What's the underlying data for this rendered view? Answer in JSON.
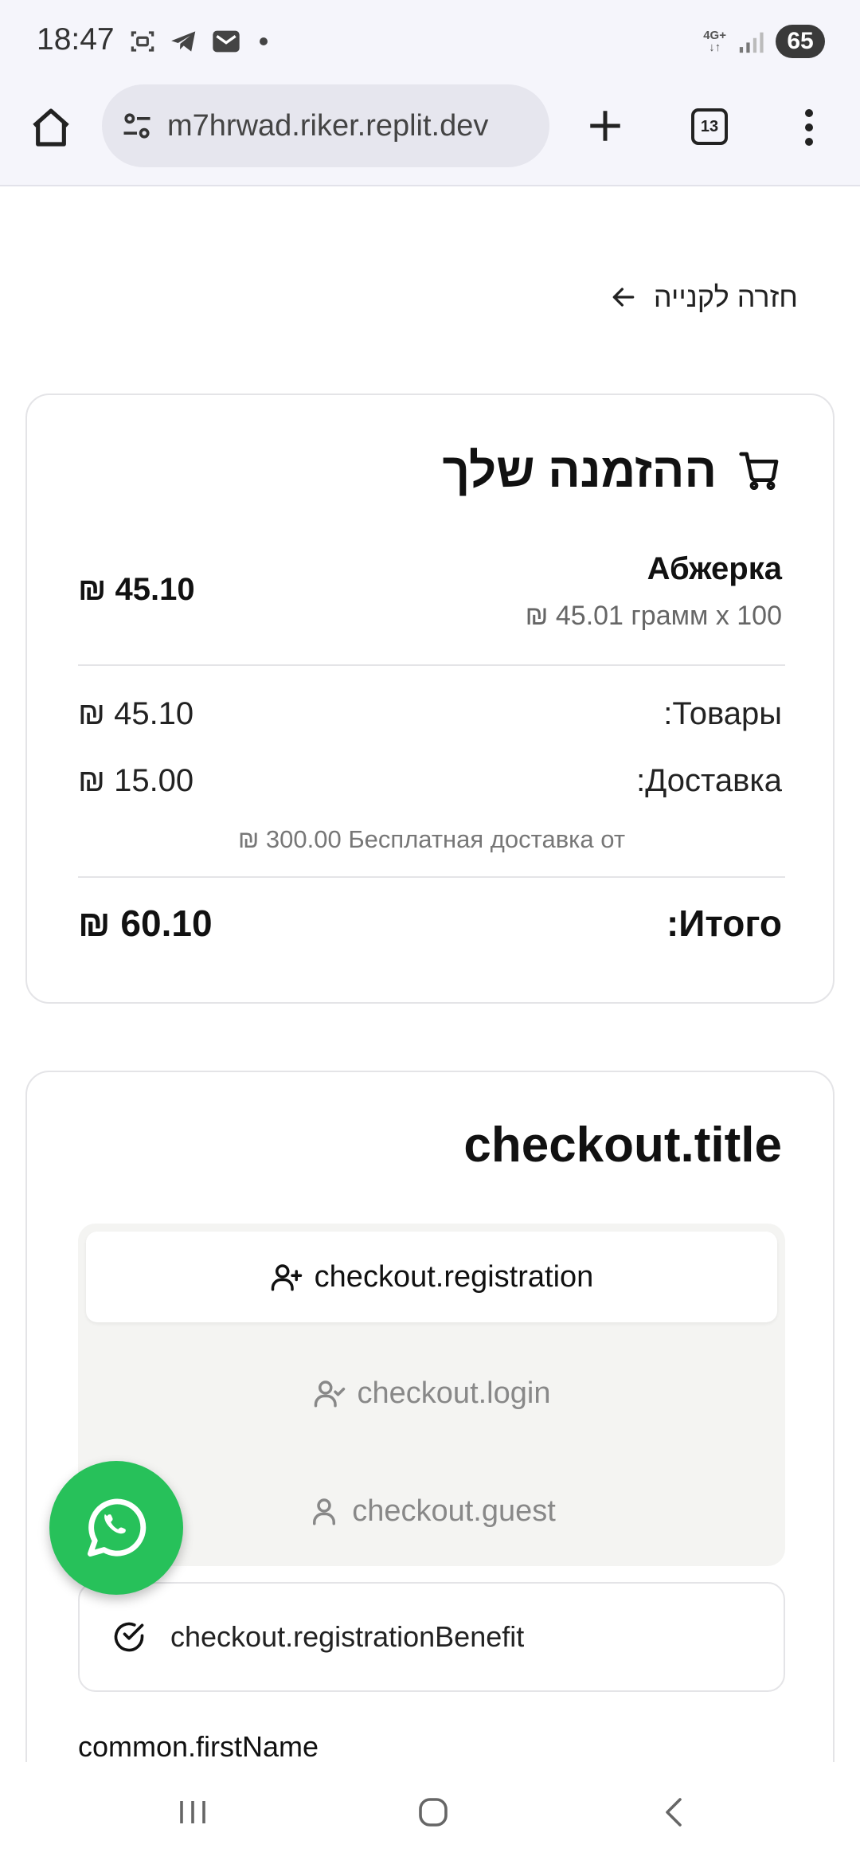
{
  "status_bar": {
    "time": "18:47",
    "network": "4G+",
    "battery": "65"
  },
  "browser": {
    "url": "m7hrwad.riker.replit.dev",
    "tab_count": "13"
  },
  "back_link": {
    "label": "חזרה לקנייה"
  },
  "order": {
    "title": "ההזמנה שלך",
    "item": {
      "name": "Абжерка",
      "detail": "₪ 45.01 грамм x 100",
      "price": "₪ 45.10"
    },
    "goods_label": ":Товары",
    "goods_value": "₪ 45.10",
    "delivery_label": ":Доставка",
    "delivery_value": "₪ 15.00",
    "free_delivery_note": "₪ 300.00 Бесплатная доставка от",
    "total_label": ":Итого",
    "total_value": "₪ 60.10"
  },
  "checkout": {
    "title": "checkout.title",
    "tabs": {
      "registration": "checkout.registration",
      "login": "checkout.login",
      "guest": "checkout.guest"
    },
    "active_tab": "registration",
    "benefit": "checkout.registrationBenefit",
    "first_name_label": "common.firstName"
  },
  "colors": {
    "whatsapp": "#27c15a",
    "browser_bar": "#f5f5fb",
    "card_border": "#e4e4e7",
    "tabs_bg": "#f4f4f2"
  }
}
